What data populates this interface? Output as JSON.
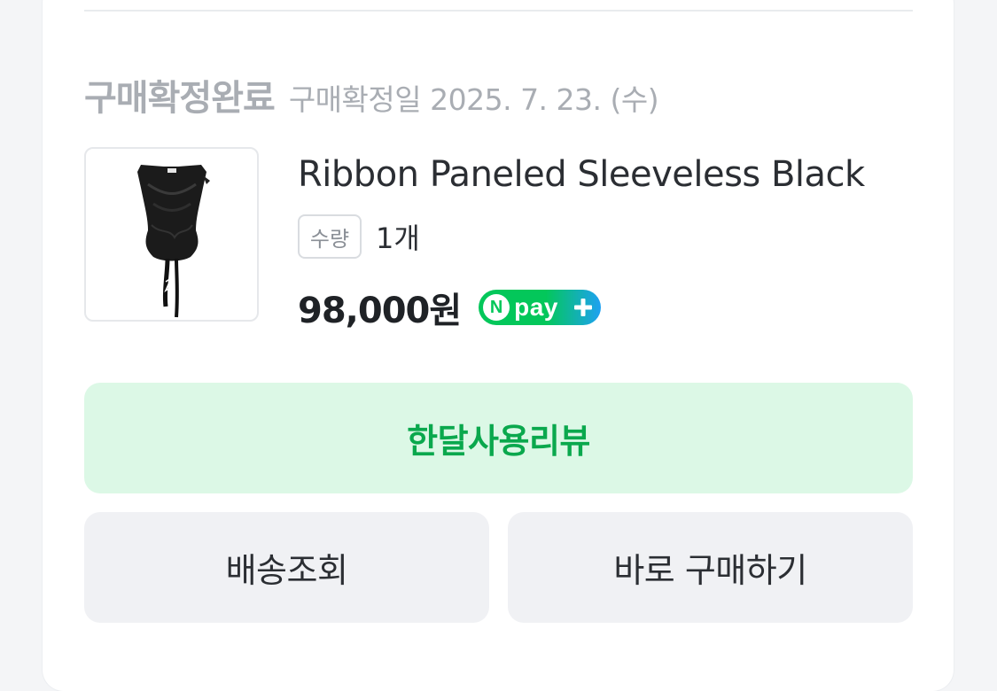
{
  "order": {
    "status_title": "구매확정완료",
    "confirm_date_label": "구매확정일 2025. 7. 23. (수)"
  },
  "product": {
    "name": "Ribbon Paneled Sleeveless Black",
    "thumbnail_icon": "sleeveless-top-image",
    "quantity_label": "수량",
    "quantity_value": "1개",
    "price": "98,000원",
    "npay": {
      "n": "N",
      "text": "pay",
      "icon": "plus-icon"
    }
  },
  "actions": {
    "review_label": "한달사용리뷰",
    "tracking_label": "배송조회",
    "buy_again_label": "바로 구매하기"
  },
  "colors": {
    "accent_green": "#0aa84d",
    "review_bg": "#dcf8e6",
    "npay_green": "#03c75a",
    "npay_blue": "#1ea1f2"
  }
}
